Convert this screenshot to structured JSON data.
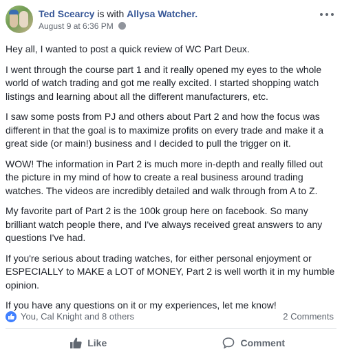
{
  "post": {
    "author": "Ted Scearcy",
    "with_text": "is with",
    "tagged": "Allysa Watcher.",
    "timestamp": "August 9 at 6:36 PM",
    "paragraphs": [
      "Hey all, I wanted to post a quick review of WC Part Deux.",
      "I went through the course part 1 and it really opened my eyes to the whole world of watch trading and got me really excited. I started shopping watch listings and learning about all the different manufacturers, etc.",
      "I saw some posts from PJ and others about Part 2 and how the focus was different in that the goal is to maximize profits on every trade and make it a great side (or main!) business and I decided to pull the trigger on it.",
      "WOW! The information in Part 2 is much more in-depth and really filled out the picture in my mind of how to create a real business around trading watches. The videos are incredibly detailed and walk through from A to Z.",
      "My favorite part of Part 2 is the 100k group here on facebook. So many brilliant watch people there, and I've always received great answers to any questions I've had.",
      "If you're serious about trading watches, for either personal enjoyment or ESPECIALLY to MAKE a LOT of MONEY, Part 2 is well worth it in my humble opinion.",
      "If you have any questions on it or my experiences, let me know!"
    ]
  },
  "stats": {
    "reactors": "You, Cal Knight and 8 others",
    "comments": "2 Comments"
  },
  "actions": {
    "like": "Like",
    "comment": "Comment"
  },
  "colors": {
    "link": "#385898",
    "like_badge": "#4080ff",
    "muted": "#606770"
  },
  "icons": [
    "more-icon",
    "globe-icon",
    "like-reaction-icon",
    "thumbs-up-icon",
    "comment-icon"
  ]
}
